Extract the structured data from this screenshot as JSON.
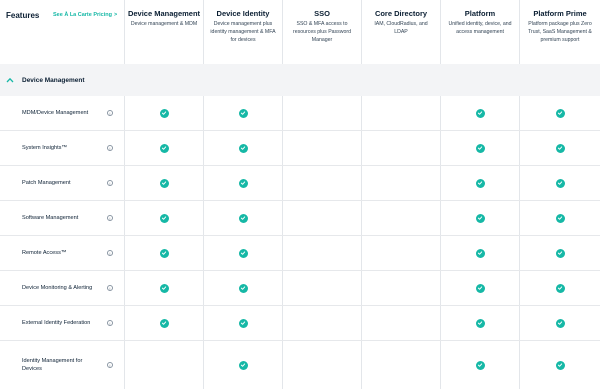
{
  "header": {
    "features_title": "Features",
    "alacarte_link": "See À La Carte Pricing",
    "alacarte_chevron": ">"
  },
  "plans": [
    {
      "name": "Device Management",
      "desc": "Device management & MDM"
    },
    {
      "name": "Device Identity",
      "desc": "Device management plus identity management & MFA for devices"
    },
    {
      "name": "SSO",
      "desc": "SSO & MFA access to resources plus Password Manager"
    },
    {
      "name": "Core Directory",
      "desc": "IAM, CloudRadius, and LDAP"
    },
    {
      "name": "Platform",
      "desc": "Unified identity, device, and access management"
    },
    {
      "name": "Platform Prime",
      "desc": "Platform package plus Zero Trust, SaaS Management & premium support"
    }
  ],
  "section": {
    "label": "Device Management",
    "icon": "chevron-up-icon",
    "expanded": true
  },
  "colors": {
    "accent": "#16b8a6",
    "section_bg": "#f3f4f6",
    "divider": "#e3e6ea",
    "text": "#0b1f33"
  },
  "info_icon_glyph": "i",
  "features": [
    {
      "name": "MDM/Device Management",
      "included": [
        true,
        true,
        false,
        false,
        true,
        true
      ]
    },
    {
      "name": "System Insights™",
      "included": [
        true,
        true,
        false,
        false,
        true,
        true
      ]
    },
    {
      "name": "Patch Management",
      "included": [
        true,
        true,
        false,
        false,
        true,
        true
      ]
    },
    {
      "name": "Software Management",
      "included": [
        true,
        true,
        false,
        false,
        true,
        true
      ]
    },
    {
      "name": "Remote Access™",
      "included": [
        true,
        true,
        false,
        false,
        true,
        true
      ]
    },
    {
      "name": "Device Monitoring & Alerting",
      "included": [
        true,
        true,
        false,
        false,
        true,
        true
      ]
    },
    {
      "name": "External Identity Federation",
      "included": [
        true,
        true,
        false,
        false,
        true,
        true
      ]
    },
    {
      "name": "Identity Management for Devices",
      "included": [
        false,
        true,
        false,
        false,
        true,
        true
      ]
    }
  ]
}
